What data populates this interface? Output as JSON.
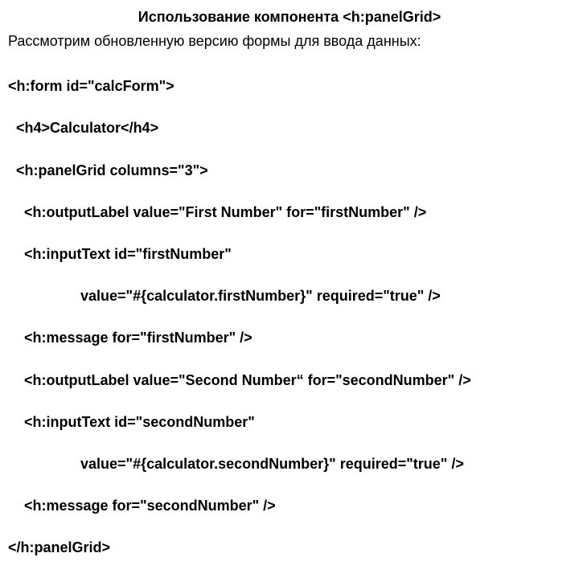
{
  "title": "Использование компонента <h:panelGrid>",
  "intro": "Рассмотрим обновленную версию формы для ввода данных:",
  "code": {
    "l1": "<h:form id=\"calcForm\">",
    "l2": "  <h4>Calculator</h4>",
    "l3": "  <h:panelGrid columns=\"3\">",
    "l4": "    <h:outputLabel value=\"First Number\" for=\"firstNumber\" />",
    "l5": "    <h:inputText id=\"firstNumber\"",
    "l6": "                  value=\"#{calculator.firstNumber}\" required=\"true\" />",
    "l7": "    <h:message for=\"firstNumber\" />",
    "l8": "    <h:outputLabel value=\"Second Number“ for=\"secondNumber\" />",
    "l9": "    <h:inputText id=\"secondNumber\"",
    "l10": "                  value=\"#{calculator.secondNumber}\" required=\"true\" />",
    "l11": "    <h:message for=\"secondNumber\" />",
    "l12": "</h:panelGrid>"
  }
}
